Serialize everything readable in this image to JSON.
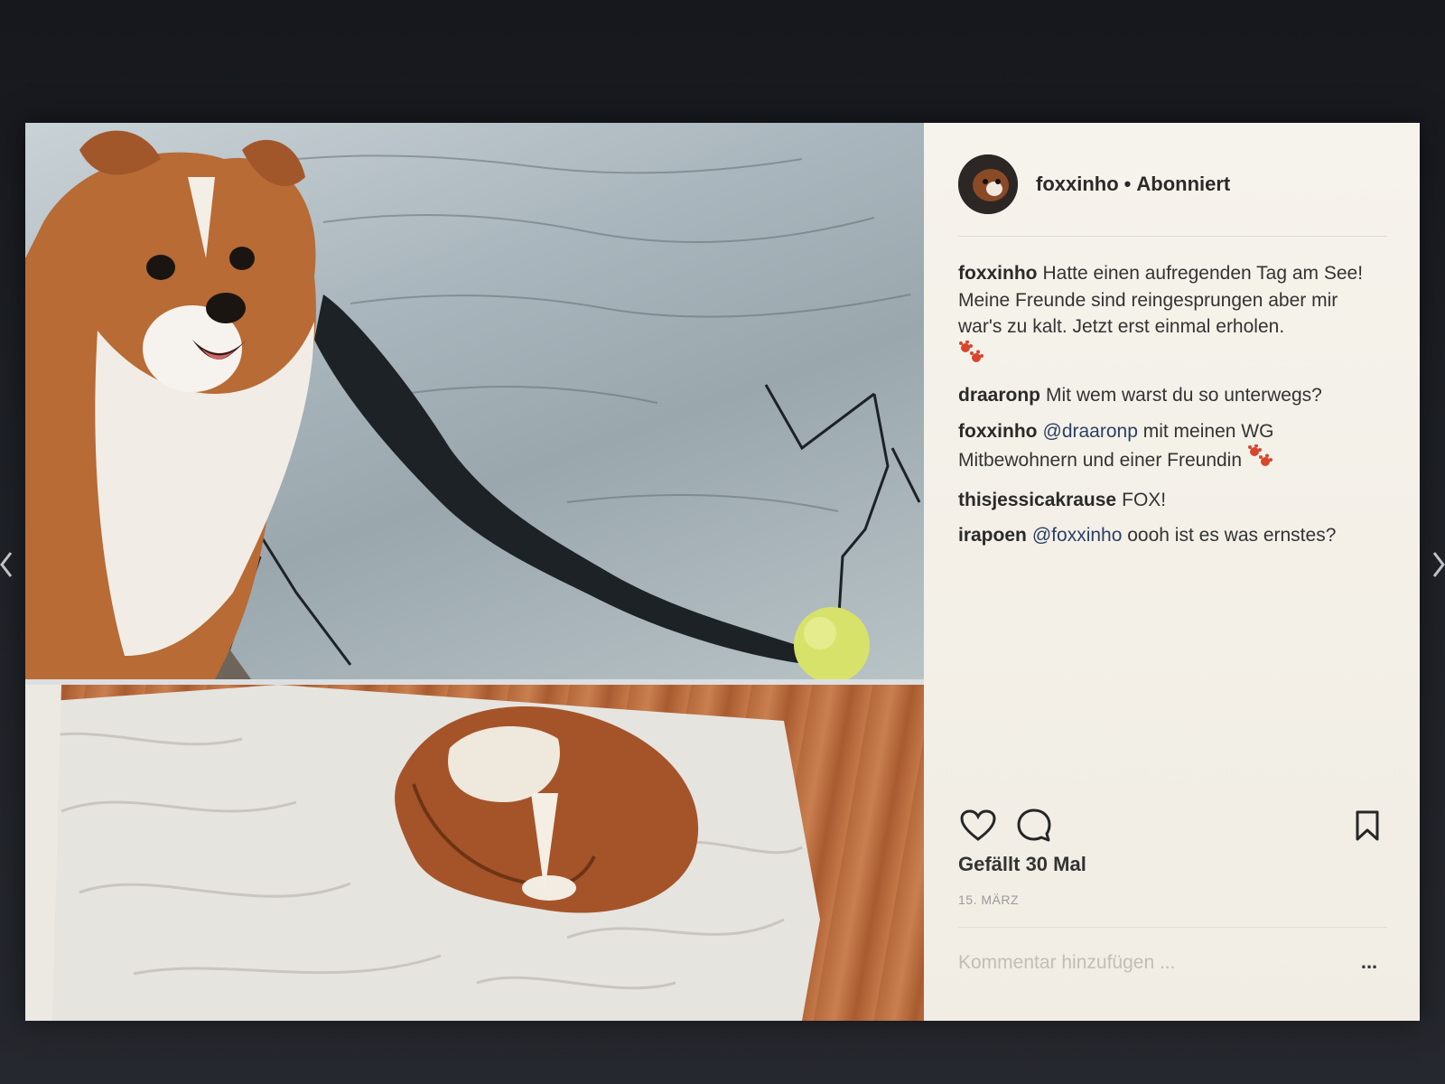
{
  "post": {
    "username": "foxxinho",
    "separator": "•",
    "follow_status": "Abonniert",
    "likes_text": "Gefällt 30 Mal",
    "date_text": "15. MÄRZ",
    "add_comment_placeholder": "Kommentar hinzufügen ...",
    "more_label": "...",
    "images": [
      {
        "description": "dog-by-lake",
        "icon": "photo"
      },
      {
        "description": "dog-on-sheets",
        "icon": "photo"
      }
    ]
  },
  "comments": [
    {
      "user": "foxxinho",
      "text": "Hatte einen aufregenden Tag am See! Meine Freunde sind reingesprungen aber mir war's zu kalt. Jetzt erst einmal erholen.",
      "emoji": "paw-prints-icon"
    },
    {
      "user": "draaronp",
      "text": "Mit wem warst du so unterwegs?"
    },
    {
      "user": "foxxinho",
      "mention": "@draaronp",
      "text": "mit meinen WG Mitbewohnern und einer Freundin",
      "emoji": "paw-prints-icon"
    },
    {
      "user": "thisjessicakrause",
      "text": "FOX!"
    },
    {
      "user": "irapoen",
      "mention": "@foxxinho",
      "text": "oooh ist es was ernstes?"
    }
  ],
  "colors": {
    "panel_bg": "#f4f1ea",
    "text": "#333333",
    "mention": "#2b3f63",
    "paw": "#d8462e"
  },
  "icons": {
    "like": "heart-icon",
    "comment": "comment-bubble-icon",
    "save": "bookmark-icon",
    "more": "more-options-icon"
  }
}
